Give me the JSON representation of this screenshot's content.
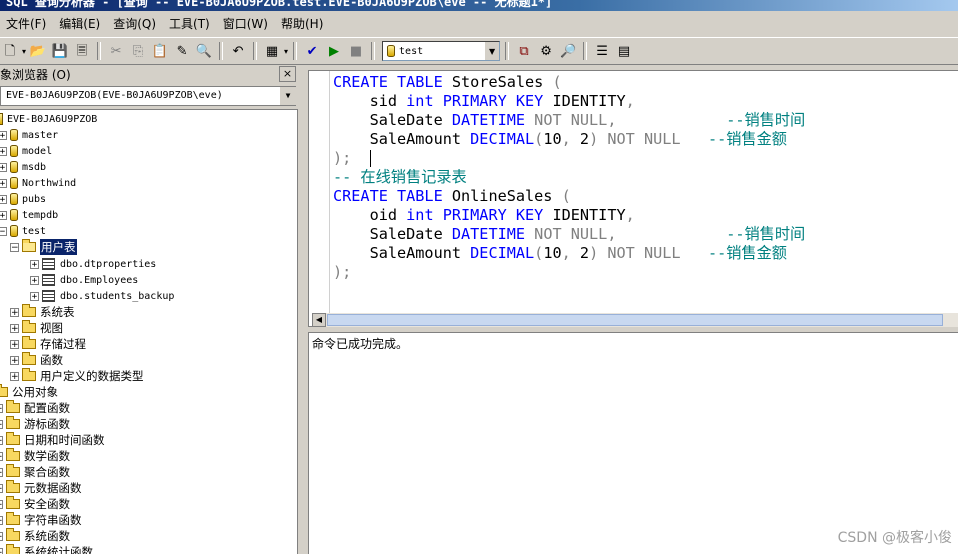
{
  "window": {
    "title": "SQL 查询分析器 - [查询 -- EVE-B0JA6U9PZOB.test.EVE-B0JA6U9PZOB\\eve -- 无标题1*]"
  },
  "menu": {
    "items": [
      {
        "label": "文件(F)"
      },
      {
        "label": "编辑(E)"
      },
      {
        "label": "查询(Q)"
      },
      {
        "label": "工具(T)"
      },
      {
        "label": "窗口(W)"
      },
      {
        "label": "帮助(H)"
      }
    ]
  },
  "toolbar": {
    "database": "test",
    "icons": [
      "new-query-icon",
      "open-icon",
      "save-icon",
      "load-script-icon",
      "cut-icon",
      "copy-icon",
      "paste-icon",
      "clear-icon",
      "find-icon",
      "undo-icon",
      "results-mode-icon",
      "parse-icon",
      "execute-icon",
      "stop-icon",
      "object-browser-icon",
      "execution-plan-icon",
      "object-search-icon",
      "properties-icon",
      "show-results-icon"
    ]
  },
  "object_browser": {
    "title": "象浏览器 (O)",
    "close": "×",
    "server_combo": "EVE-B0JA6U9PZOB(EVE-B0JA6U9PZOB\\eve)",
    "server_node": "EVE-B0JA6U9PZOB",
    "databases": [
      "master",
      "model",
      "msdb",
      "Northwind",
      "pubs",
      "tempdb",
      "test"
    ],
    "test_children": {
      "user_tables": "用户表",
      "tables": [
        "dbo.dtproperties",
        "dbo.Employees",
        "dbo.students_backup"
      ],
      "folders": [
        "系统表",
        "视图",
        "存储过程",
        "函数",
        "用户定义的数据类型"
      ]
    },
    "common_objects": {
      "label": "公用对象",
      "folders": [
        "配置函数",
        "游标函数",
        "日期和时间函数",
        "数学函数",
        "聚合函数",
        "元数据函数",
        "安全函数",
        "字符串函数",
        "系统函数",
        "系统统计函数"
      ]
    }
  },
  "editor": {
    "lines": [
      [
        {
          "t": "CREATE TABLE ",
          "c": "kw"
        },
        {
          "t": "StoreSales ",
          "c": "tx"
        },
        {
          "t": "(",
          "c": "gr"
        }
      ],
      [
        {
          "t": "    sid ",
          "c": "tx"
        },
        {
          "t": "int PRIMARY KEY ",
          "c": "kw"
        },
        {
          "t": "IDENTITY",
          "c": "tx"
        },
        {
          "t": ",",
          "c": "gr"
        }
      ],
      [
        {
          "t": "    SaleDate ",
          "c": "tx"
        },
        {
          "t": "DATETIME ",
          "c": "kw"
        },
        {
          "t": "NOT NULL,",
          "c": "gr"
        },
        {
          "t": "            --销售时间",
          "c": "cm"
        }
      ],
      [
        {
          "t": "    SaleAmount ",
          "c": "tx"
        },
        {
          "t": "DECIMAL",
          "c": "kw"
        },
        {
          "t": "(",
          "c": "gr"
        },
        {
          "t": "10",
          "c": "tx"
        },
        {
          "t": ", ",
          "c": "gr"
        },
        {
          "t": "2",
          "c": "tx"
        },
        {
          "t": ") NOT NULL",
          "c": "gr"
        },
        {
          "t": "   --销售金额",
          "c": "cm"
        }
      ],
      [
        {
          "t": ");  ",
          "c": "gr"
        }
      ],
      [
        {
          "t": "-- 在线销售记录表",
          "c": "cm"
        }
      ],
      [
        {
          "t": "CREATE TABLE ",
          "c": "kw"
        },
        {
          "t": "OnlineSales ",
          "c": "tx"
        },
        {
          "t": "(",
          "c": "gr"
        }
      ],
      [
        {
          "t": "    oid ",
          "c": "tx"
        },
        {
          "t": "int PRIMARY KEY ",
          "c": "kw"
        },
        {
          "t": "IDENTITY",
          "c": "tx"
        },
        {
          "t": ",",
          "c": "gr"
        }
      ],
      [
        {
          "t": "    SaleDate ",
          "c": "tx"
        },
        {
          "t": "DATETIME ",
          "c": "kw"
        },
        {
          "t": "NOT NULL,",
          "c": "gr"
        },
        {
          "t": "            --销售时间",
          "c": "cm"
        }
      ],
      [
        {
          "t": "    SaleAmount ",
          "c": "tx"
        },
        {
          "t": "DECIMAL",
          "c": "kw"
        },
        {
          "t": "(",
          "c": "gr"
        },
        {
          "t": "10",
          "c": "tx"
        },
        {
          "t": ", ",
          "c": "gr"
        },
        {
          "t": "2",
          "c": "tx"
        },
        {
          "t": ") NOT NULL",
          "c": "gr"
        },
        {
          "t": "   --销售金额",
          "c": "cm"
        }
      ],
      [
        {
          "t": ");",
          "c": "gr"
        }
      ]
    ]
  },
  "results": {
    "message": "命令已成功完成。"
  },
  "watermark": "CSDN @极客小俊"
}
